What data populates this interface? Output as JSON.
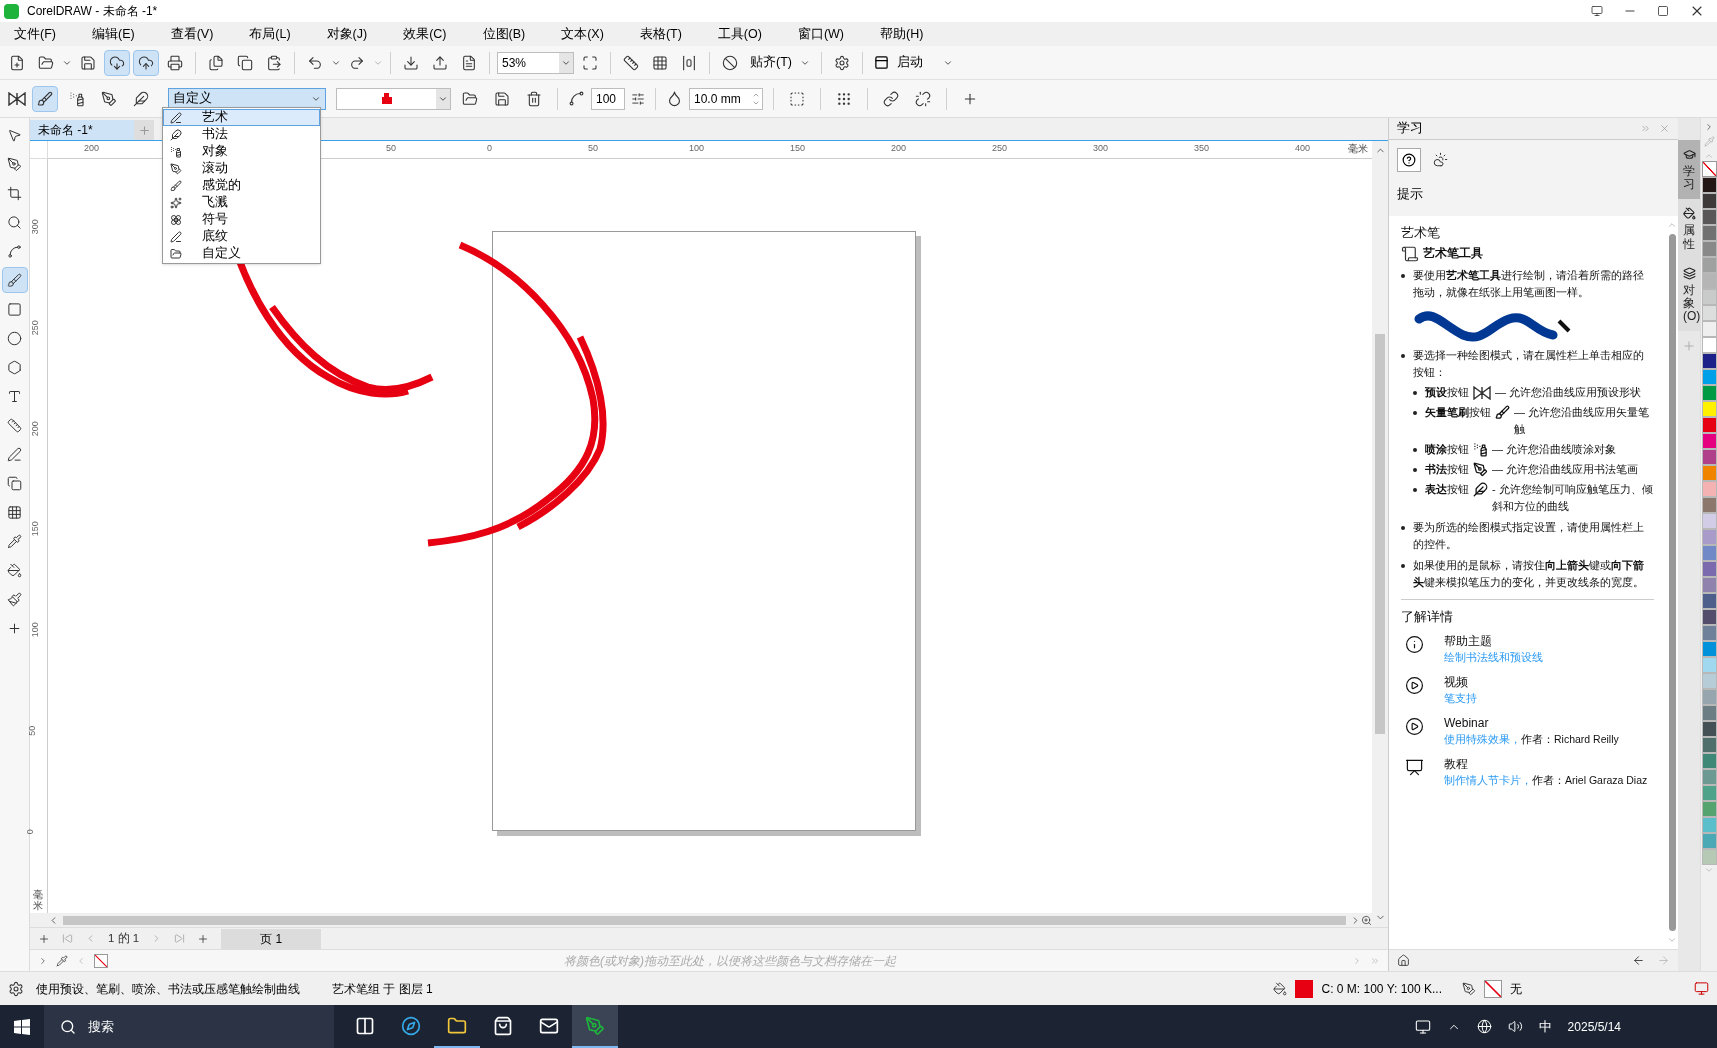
{
  "window": {
    "title": "CorelDRAW - 未命名 -1*"
  },
  "menu": [
    "文件(F)",
    "编辑(E)",
    "查看(V)",
    "布局(L)",
    "对象(J)",
    "效果(C)",
    "位图(B)",
    "文本(X)",
    "表格(T)",
    "工具(O)",
    "窗口(W)",
    "帮助(H)"
  ],
  "toolbar": {
    "zoom": "53%",
    "snap": "贴齐(T)",
    "launch": "启动"
  },
  "property_bar": {
    "preset": "自定义",
    "smoothing": "100",
    "width": "10.0 mm"
  },
  "preset_dropdown": [
    {
      "label": "艺术",
      "kind": "art",
      "selected": true
    },
    {
      "label": "书法",
      "kind": "calligraphy",
      "selected": false
    },
    {
      "label": "对象",
      "kind": "object",
      "selected": false
    },
    {
      "label": "滚动",
      "kind": "scroll",
      "selected": false
    },
    {
      "label": "感觉的",
      "kind": "sense",
      "selected": false
    },
    {
      "label": "飞溅",
      "kind": "splash",
      "selected": false
    },
    {
      "label": "符号",
      "kind": "symbol",
      "selected": false
    },
    {
      "label": "底纹",
      "kind": "texture",
      "selected": false
    },
    {
      "label": "自定义",
      "kind": "folder",
      "selected": false
    }
  ],
  "document_tab": {
    "label": "未命名 -1*",
    "selected": true
  },
  "ruler": {
    "horizontal": [
      "200",
      "50",
      "0",
      "50",
      "100",
      "150",
      "200",
      "250",
      "300",
      "350",
      "400"
    ],
    "horizontal_unit": "毫米",
    "vertical": [
      "300",
      "250",
      "200",
      "150",
      "100",
      "50",
      "0"
    ],
    "vertical_unit": "毫米"
  },
  "page_nav": {
    "position": "1 的 1",
    "page_tab": "页 1"
  },
  "palette_tray": {
    "hint": "将颜色(或对象)拖动至此处，以便将这些颜色与文档存储在一起"
  },
  "status_bar": {
    "hint": "使用预设、笔刷、喷涂、书法或压感笔触绘制曲线",
    "object": "艺术笔组 于 图层 1",
    "fill": "C: 0 M: 100 Y: 100 K...",
    "outline": "无"
  },
  "learn_panel": {
    "title": "学习",
    "section": "提示",
    "heading": "艺术笔",
    "tool": "艺术笔工具",
    "intro": "要使用**艺术笔工具**进行绘制，请沿着所需的路径拖动，就像在纸张上用笔画图一样。",
    "modes_intro": "要选择一种绘图模式，请在属性栏上单击相应的按钮：",
    "modes": [
      {
        "kind": "preset",
        "label": "**预设**按钮",
        "description": "— 允许您沿曲线应用预设形状"
      },
      {
        "kind": "brush",
        "label": "**矢量笔刷**按钮",
        "description": "— 允许您沿曲线应用矢量笔触"
      },
      {
        "kind": "sprayer",
        "label": "**喷涂**按钮",
        "description": "— 允许您沿曲线喷涂对象"
      },
      {
        "kind": "calligraphic",
        "label": "**书法**按钮",
        "description": "— 允许您沿曲线应用书法笔画"
      },
      {
        "kind": "expression",
        "label": "**表达**按钮",
        "description": "- 允许您绘制可响应触笔压力、倾斜和方位的曲线"
      }
    ],
    "notes": [
      "要为所选的绘图模式指定设置，请使用属性栏上的控件。",
      "如果使用的是鼠标，请按住**向上箭头**键或**向下箭头**键来模拟笔压力的变化，并更改线条的宽度。"
    ],
    "more_title": "了解详情",
    "resources": [
      {
        "kind": "help",
        "title": "帮助主题",
        "link": "绘制书法线和预设线"
      },
      {
        "kind": "video",
        "title": "视频",
        "link": "笔支持"
      },
      {
        "kind": "video",
        "title": "Webinar",
        "link": "使用特殊效果，",
        "author": "作者：Richard Reilly"
      },
      {
        "kind": "tutorial",
        "title": "教程",
        "link": "制作情人节卡片，",
        "author": "作者：Ariel Garaza Diaz"
      }
    ]
  },
  "docker_tabs": [
    {
      "label": "学习",
      "selected": true
    },
    {
      "label": "属性",
      "selected": false
    },
    {
      "label": "对象(O)",
      "selected": false
    }
  ],
  "palette": [
    {
      "kind": "none"
    },
    {
      "kind": "swatch",
      "color": "#231815"
    },
    {
      "kind": "swatch",
      "color": "#3e3a39"
    },
    {
      "kind": "swatch",
      "color": "#595757"
    },
    {
      "kind": "swatch",
      "color": "#727171"
    },
    {
      "kind": "swatch",
      "color": "#898989"
    },
    {
      "kind": "swatch",
      "color": "#9fa0a0"
    },
    {
      "kind": "swatch",
      "color": "#b5b5b6"
    },
    {
      "kind": "swatch",
      "color": "#c9caca"
    },
    {
      "kind": "swatch",
      "color": "#dcdddd"
    },
    {
      "kind": "swatch",
      "color": "#efefef"
    },
    {
      "kind": "swatch",
      "color": "#ffffff"
    },
    {
      "kind": "swatch",
      "color": "#1d2088"
    },
    {
      "kind": "swatch",
      "color": "#00a0e9"
    },
    {
      "kind": "swatch",
      "color": "#009944"
    },
    {
      "kind": "swatch",
      "color": "#fff100"
    },
    {
      "kind": "swatch",
      "color": "#e60012"
    },
    {
      "kind": "swatch",
      "color": "#e4007f"
    },
    {
      "kind": "swatch",
      "color": "#b0408a"
    },
    {
      "kind": "swatch",
      "color": "#f08300"
    },
    {
      "kind": "swatch",
      "color": "#f5b2b2"
    },
    {
      "kind": "swatch",
      "color": "#8c776c"
    },
    {
      "kind": "swatch",
      "color": "#d3cce6"
    },
    {
      "kind": "swatch",
      "color": "#a99bc9"
    },
    {
      "kind": "swatch",
      "color": "#7289c7"
    },
    {
      "kind": "swatch",
      "color": "#7c6aae"
    },
    {
      "kind": "swatch",
      "color": "#8f82ac"
    },
    {
      "kind": "swatch",
      "color": "#4e5f8c"
    },
    {
      "kind": "swatch",
      "color": "#544d6b"
    },
    {
      "kind": "swatch",
      "color": "#6f819a"
    },
    {
      "kind": "swatch",
      "color": "#0091db"
    },
    {
      "kind": "swatch",
      "color": "#a0d8ef"
    },
    {
      "kind": "swatch",
      "color": "#b6cdd8"
    },
    {
      "kind": "swatch",
      "color": "#97a6ae"
    },
    {
      "kind": "swatch",
      "color": "#6d7d84"
    },
    {
      "kind": "swatch",
      "color": "#444f56"
    },
    {
      "kind": "swatch",
      "color": "#4e6f6c"
    },
    {
      "kind": "swatch",
      "color": "#3f8877"
    },
    {
      "kind": "swatch",
      "color": "#6c9a92"
    },
    {
      "kind": "swatch",
      "color": "#4ea28a"
    },
    {
      "kind": "swatch",
      "color": "#55a46f"
    },
    {
      "kind": "swatch",
      "color": "#5abfcb"
    },
    {
      "kind": "swatch",
      "color": "#4aa9b5"
    },
    {
      "kind": "swatch",
      "color": "#b5c9b5"
    }
  ],
  "taskbar": {
    "search": "搜索",
    "ime": "中",
    "date": "2025/5/14"
  }
}
